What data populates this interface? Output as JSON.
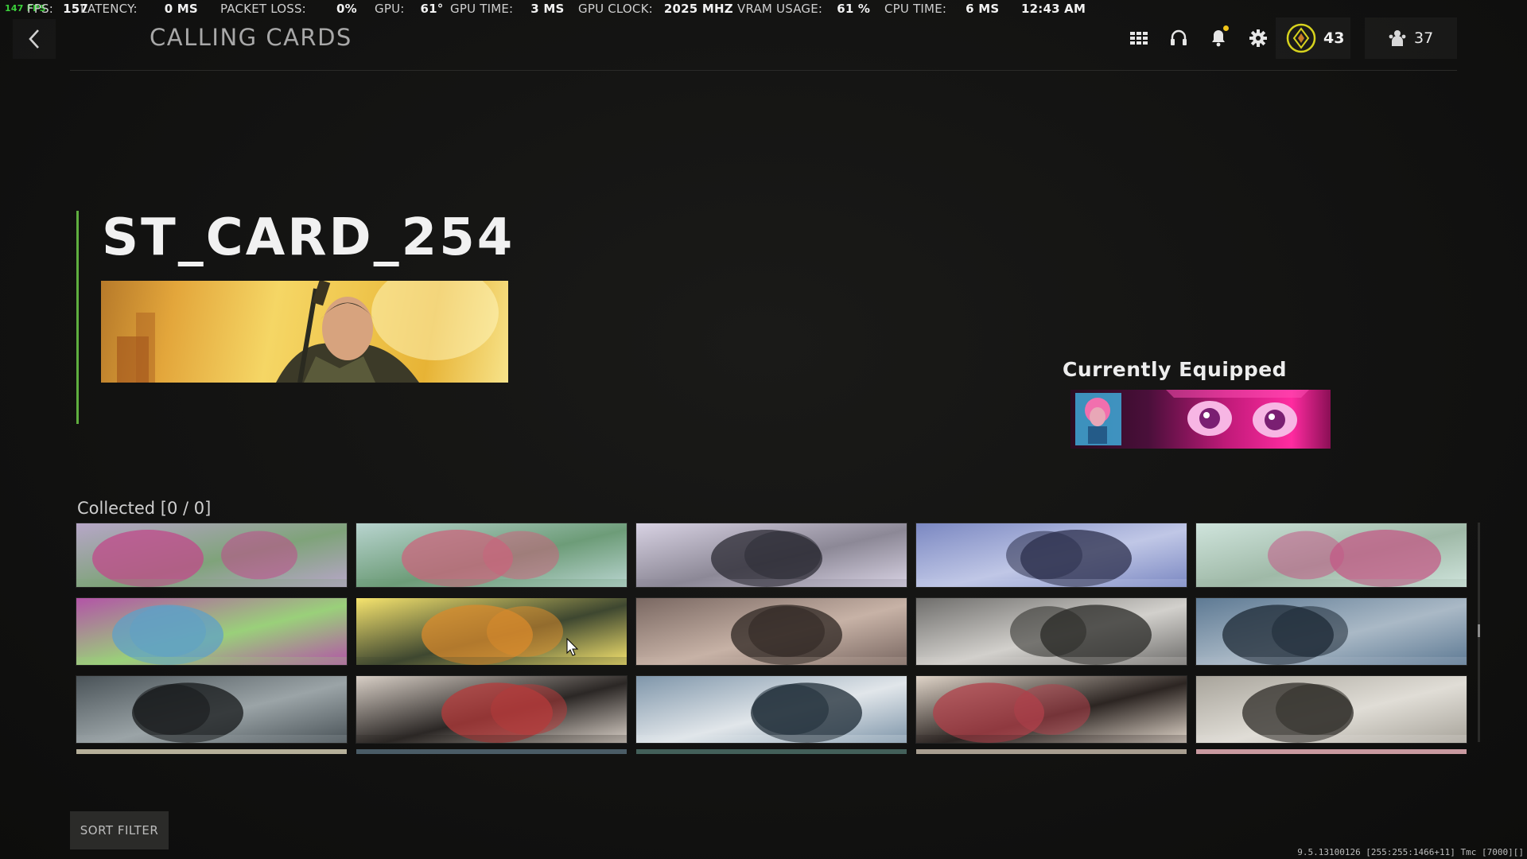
{
  "stats_bar": {
    "fps_tag": "147 FPS",
    "fps_label": "FPS:",
    "fps_value": "157",
    "latency_label": "LATENCY:",
    "latency_value": "0 MS",
    "packet_loss_label": "PACKET LOSS:",
    "packet_loss_value": "0%",
    "gpu_label": "GPU:",
    "gpu_value": "61°",
    "gpu_time_label": "GPU TIME:",
    "gpu_time_value": "3 MS",
    "gpu_clock_label": "GPU CLOCK:",
    "gpu_clock_value": "2025 MHZ",
    "vram_label": "VRAM USAGE:",
    "vram_value": "61 %",
    "cpu_time_label": "CPU TIME:",
    "cpu_time_value": "6 MS",
    "clock": "12:43 AM"
  },
  "header": {
    "title": "CALLING CARDS",
    "icons": [
      "grid-menu-icon",
      "headset-icon",
      "bell-icon",
      "gear-icon"
    ],
    "rank_value": "43",
    "friends_count": "37"
  },
  "selected_card": {
    "name": "ST_CARD_254"
  },
  "equipped": {
    "label": "Currently Equipped"
  },
  "collected": {
    "label": "Collected [0 / 0]",
    "selected_index": 6,
    "tiles": [
      {
        "palette": [
          "#b7a6c8",
          "#c04a8a",
          "#7fa37a"
        ]
      },
      {
        "palette": [
          "#b8d4cf",
          "#c9657c",
          "#6d9c78"
        ]
      },
      {
        "palette": [
          "#d8d2e3",
          "#2c2b34",
          "#8c8896"
        ]
      },
      {
        "palette": [
          "#7b88c2",
          "#2c2f4c",
          "#c0c7e6"
        ]
      },
      {
        "palette": [
          "#cfe4dc",
          "#c35a86",
          "#9fb9a7"
        ]
      },
      {
        "palette": [
          "#b354a7",
          "#5fa0c7",
          "#9ad07a"
        ]
      },
      {
        "palette": [
          "#f6e46e",
          "#d88a2c",
          "#3e4730"
        ]
      },
      {
        "palette": [
          "#7a6862",
          "#2e2521",
          "#c7b2a6"
        ]
      },
      {
        "palette": [
          "#6f6e6c",
          "#2a2927",
          "#d2d0cc"
        ]
      },
      {
        "palette": [
          "#5e7a94",
          "#1d2a36",
          "#aab9c6"
        ]
      },
      {
        "palette": [
          "#4a5358",
          "#161819",
          "#9ba4a7"
        ]
      },
      {
        "palette": [
          "#d8cfc6",
          "#b53b3b",
          "#2b2725"
        ]
      },
      {
        "palette": [
          "#7f96aa",
          "#1e2b36",
          "#e1e6ea"
        ]
      },
      {
        "palette": [
          "#dfd4c8",
          "#b0404a",
          "#2c2522"
        ]
      },
      {
        "palette": [
          "#a8a49b",
          "#2d2b27",
          "#e0ddd6"
        ]
      }
    ],
    "partial_row_colors": [
      "#b6b09a",
      "#4a5c66",
      "#43605a",
      "#a89e90",
      "#c99aa0"
    ]
  },
  "footer": {
    "sort_filter_label": "SORT FILTER",
    "build_info": "9.5.13100126 [255:255:1466+11] Tmc [7000][]"
  }
}
